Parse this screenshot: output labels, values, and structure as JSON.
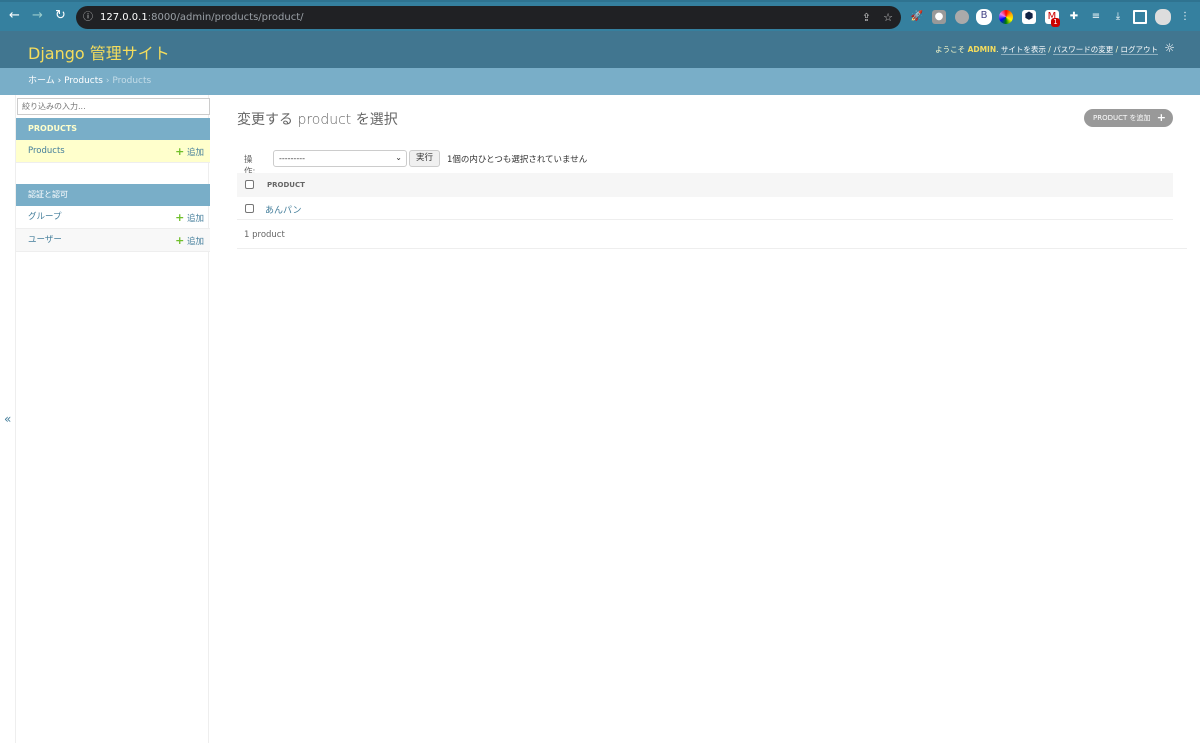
{
  "browser": {
    "url_host": "127.0.0.1",
    "url_rest": ":8000/admin/products/product/",
    "ext_badge": "1"
  },
  "header": {
    "brand": "Django 管理サイト",
    "welcome": "ようこそ",
    "user": "ADMIN",
    "view_site": "サイトを表示",
    "change_password": "パスワードの変更",
    "logout": "ログアウト"
  },
  "breadcrumbs": {
    "home": "ホーム",
    "app": "Products",
    "current": "Products",
    "sep": "›"
  },
  "sidebar": {
    "filter_placeholder": "絞り込みの入力...",
    "collapse": "«",
    "modules": [
      {
        "caption": "PRODUCTS",
        "items": [
          {
            "label": "Products",
            "add": "追加"
          }
        ]
      },
      {
        "caption": "認証と認可",
        "items": [
          {
            "label": "グループ",
            "add": "追加"
          },
          {
            "label": "ユーザー",
            "add": "追加"
          }
        ]
      }
    ]
  },
  "main": {
    "title": "変更する product を選択",
    "add_button": "PRODUCT を追加",
    "action_label": "操作:",
    "action_selected": "---------",
    "go": "実行",
    "selection_count": "1個の内ひとつも選択されていません",
    "column": "PRODUCT",
    "rows": [
      {
        "name": "あんパン"
      }
    ],
    "paginator": "1 product"
  },
  "colors": {
    "header": "#417690",
    "breadcrumb": "#79aec8",
    "brand": "#f5dd5d",
    "link": "#447e9b",
    "selected": "#ffffcc"
  }
}
